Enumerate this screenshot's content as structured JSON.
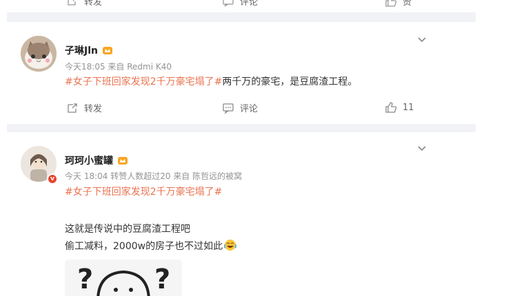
{
  "top_actions": {
    "repost": "转发",
    "comment": "评论",
    "like": "赞"
  },
  "posts": [
    {
      "username": "子琳Jln",
      "meta": "今天18:05  来自 Redmi K40",
      "topic": "#女子下班回家发现2千万豪宅塌了#",
      "text": "两千万的豪宅，是豆腐渣工程。",
      "actions": {
        "repost": "转发",
        "comment": "评论",
        "likes": "11"
      }
    },
    {
      "username": "珂珂小蜜罐",
      "meta": "今天 18:04 转赞人数超过20  来自 陈哲远的被窝",
      "topic": "#女子下班回家发现2千万豪宅塌了#",
      "line1": "这就是传说中的豆腐渣工程吧",
      "line2": "偷工减料，2000w的房子也不过如此",
      "image_text": "?( ··)?"
    }
  ],
  "colors": {
    "topic": "#eb7350",
    "separator": "#f1f2f5",
    "meta": "#939393"
  },
  "icons": [
    "repost-icon",
    "comment-icon",
    "like-icon",
    "chevron-down-icon",
    "crown-badge-icon",
    "verified-icon",
    "laugh-cry-emoji"
  ]
}
